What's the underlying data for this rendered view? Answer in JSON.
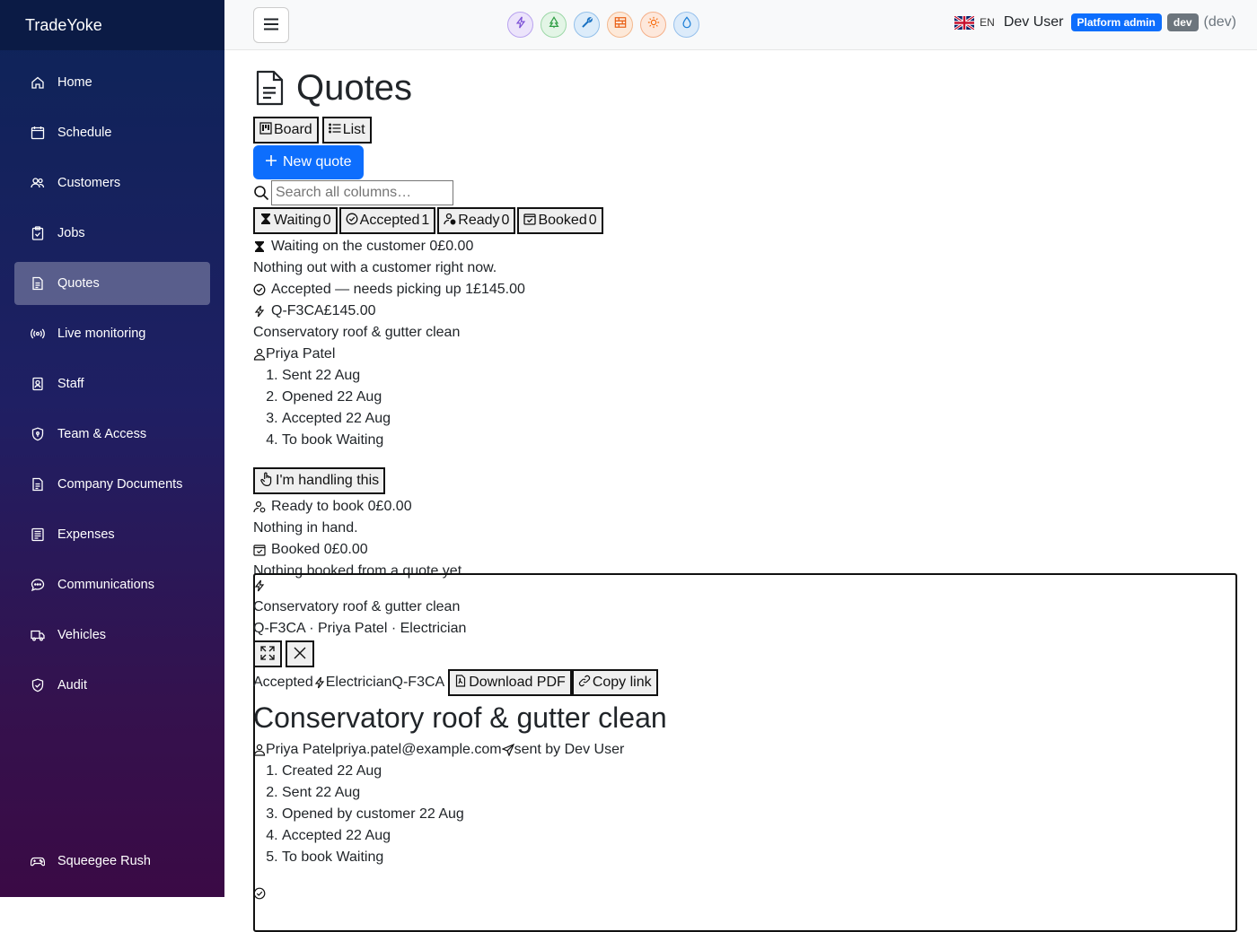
{
  "app": {
    "brand": "TradeYoke"
  },
  "sidebar": {
    "items": [
      {
        "label": "Home",
        "icon": "home-icon"
      },
      {
        "label": "Schedule",
        "icon": "calendar-icon"
      },
      {
        "label": "Customers",
        "icon": "people-icon"
      },
      {
        "label": "Jobs",
        "icon": "clipboard-icon"
      },
      {
        "label": "Quotes",
        "icon": "document-icon",
        "active": true
      },
      {
        "label": "Live monitoring",
        "icon": "broadcast-icon"
      },
      {
        "label": "Staff",
        "icon": "badge-icon"
      },
      {
        "label": "Team & Access",
        "icon": "shield-icon"
      },
      {
        "label": "Company Documents",
        "icon": "document-icon"
      },
      {
        "label": "Expenses",
        "icon": "receipt-icon"
      },
      {
        "label": "Communications",
        "icon": "chat-icon"
      },
      {
        "label": "Vehicles",
        "icon": "truck-icon"
      },
      {
        "label": "Audit",
        "icon": "shield-check-icon"
      }
    ],
    "footer": {
      "label": "Squeegee Rush",
      "icon": "gamepad-icon"
    }
  },
  "topbar": {
    "trade_pills": [
      {
        "icon": "lightning-icon",
        "color": "#7b4fd6",
        "bg": "#ece4fb"
      },
      {
        "icon": "tree-icon",
        "color": "#2f9e44",
        "bg": "#e3f5e6"
      },
      {
        "icon": "wrench-icon",
        "color": "#1971c2",
        "bg": "#dcecfa"
      },
      {
        "icon": "bricks-icon",
        "color": "#e8590c",
        "bg": "#fde9d9"
      },
      {
        "icon": "sun-icon",
        "color": "#f76707",
        "bg": "#fde8dc"
      },
      {
        "icon": "droplet-icon",
        "color": "#1c7ed6",
        "bg": "#dcebfa"
      }
    ],
    "lang": "EN",
    "user": "Dev User",
    "role_badge": "Platform admin",
    "env_badge": "dev",
    "env_paren": "(dev)"
  },
  "page": {
    "title": "Quotes",
    "view_board": "Board",
    "view_list": "List",
    "new_quote": "New quote",
    "search_placeholder": "Search all columns…"
  },
  "filters": [
    {
      "label": "Waiting",
      "count": "0"
    },
    {
      "label": "Accepted",
      "count": "1"
    },
    {
      "label": "Ready",
      "count": "0"
    },
    {
      "label": "Booked",
      "count": "0"
    }
  ],
  "columns": {
    "waiting": {
      "heading": "Waiting on the customer",
      "count": "0",
      "total": "£0.00",
      "empty": "Nothing out with a customer right now."
    },
    "accepted": {
      "heading": "Accepted — needs picking up",
      "count": "1",
      "total": "£145.00"
    },
    "ready": {
      "heading": "Ready to book",
      "count": "0",
      "total": "£0.00",
      "empty": "Nothing in hand."
    },
    "booked": {
      "heading": "Booked",
      "count": "0",
      "total": "£0.00",
      "empty": "Nothing booked from a quote yet."
    }
  },
  "card": {
    "ref": "Q-F3CA",
    "amount": "£145.00",
    "title": "Conservatory roof & gutter clean",
    "customer": "Priya Patel",
    "timeline": [
      "Sent 22 Aug",
      "Opened 22 Aug",
      "Accepted 22 Aug",
      "To book Waiting"
    ],
    "handle_btn": "I'm handling this"
  },
  "panel": {
    "title": "Conservatory roof & gutter clean",
    "subline": "Q-F3CA · Priya Patel · Electrician",
    "status": "Accepted",
    "trade": "Electrician",
    "ref": "Q-F3CA",
    "download": "Download PDF",
    "copy": "Copy link",
    "heading": "Conservatory roof & gutter clean",
    "customer": "Priya Patel",
    "email": "priya.patel@example.com",
    "sent_by": "sent by Dev User",
    "timeline": [
      "Created 22 Aug",
      "Sent 22 Aug",
      "Opened by customer 22 Aug",
      "Accepted 22 Aug",
      "To book Waiting"
    ]
  }
}
